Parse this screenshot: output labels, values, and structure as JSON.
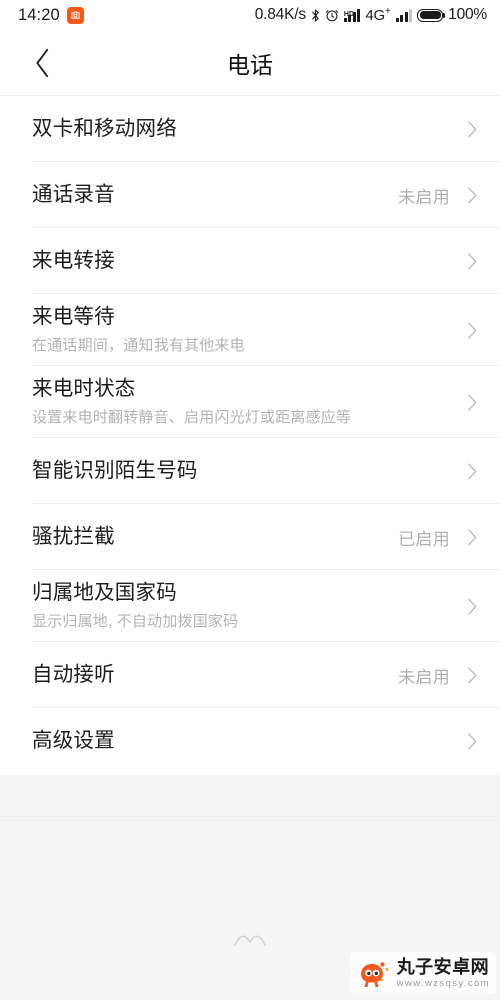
{
  "status_bar": {
    "time": "14:20",
    "app_badge_icon": "orange-app-icon",
    "network_speed": "0.84K/s",
    "bluetooth_icon": "bluetooth-icon",
    "alarm_icon": "alarm-clock-icon",
    "hd_label": "HD",
    "signal_icon": "signal-bars-icon",
    "network_type": "4G",
    "network_type_sup": "+",
    "signal_icon_2": "signal-bars-icon",
    "battery_icon": "battery-icon",
    "battery_percent": "100%",
    "battery_level": 100
  },
  "header": {
    "back_icon": "back-chevron-icon",
    "title": "电话"
  },
  "list": {
    "chevron_icon": "chevron-right-icon",
    "items": [
      {
        "title": "双卡和移动网络",
        "subtitle": "",
        "value": ""
      },
      {
        "title": "通话录音",
        "subtitle": "",
        "value": "未启用"
      },
      {
        "title": "来电转接",
        "subtitle": "",
        "value": ""
      },
      {
        "title": "来电等待",
        "subtitle": "在通话期间，通知我有其他来电",
        "value": ""
      },
      {
        "title": "来电时状态",
        "subtitle": "设置来电时翻转静音、启用闪光灯或距离感应等",
        "value": ""
      },
      {
        "title": "智能识别陌生号码",
        "subtitle": "",
        "value": ""
      },
      {
        "title": "骚扰拦截",
        "subtitle": "",
        "value": "已启用"
      },
      {
        "title": "归属地及国家码",
        "subtitle": "显示归属地, 不自动加拨国家码",
        "value": ""
      },
      {
        "title": "自动接听",
        "subtitle": "",
        "value": "未启用"
      },
      {
        "title": "高级设置",
        "subtitle": "",
        "value": ""
      }
    ]
  },
  "bottom": {
    "home_indicator_icon": "home-gesture-arc-icon"
  },
  "watermark": {
    "logo_icon": "wanzi-mascot-logo",
    "name": "丸子安卓网",
    "url": "www.wzsqsy.com"
  },
  "colors": {
    "accent": "#f75a18",
    "page_bg": "#f4f4f4",
    "card_bg": "#ffffff",
    "title_text": "#1c1c1c",
    "sub_text": "#b4b4b4",
    "value_text": "#b0b0b0",
    "divider": "#ececec"
  }
}
